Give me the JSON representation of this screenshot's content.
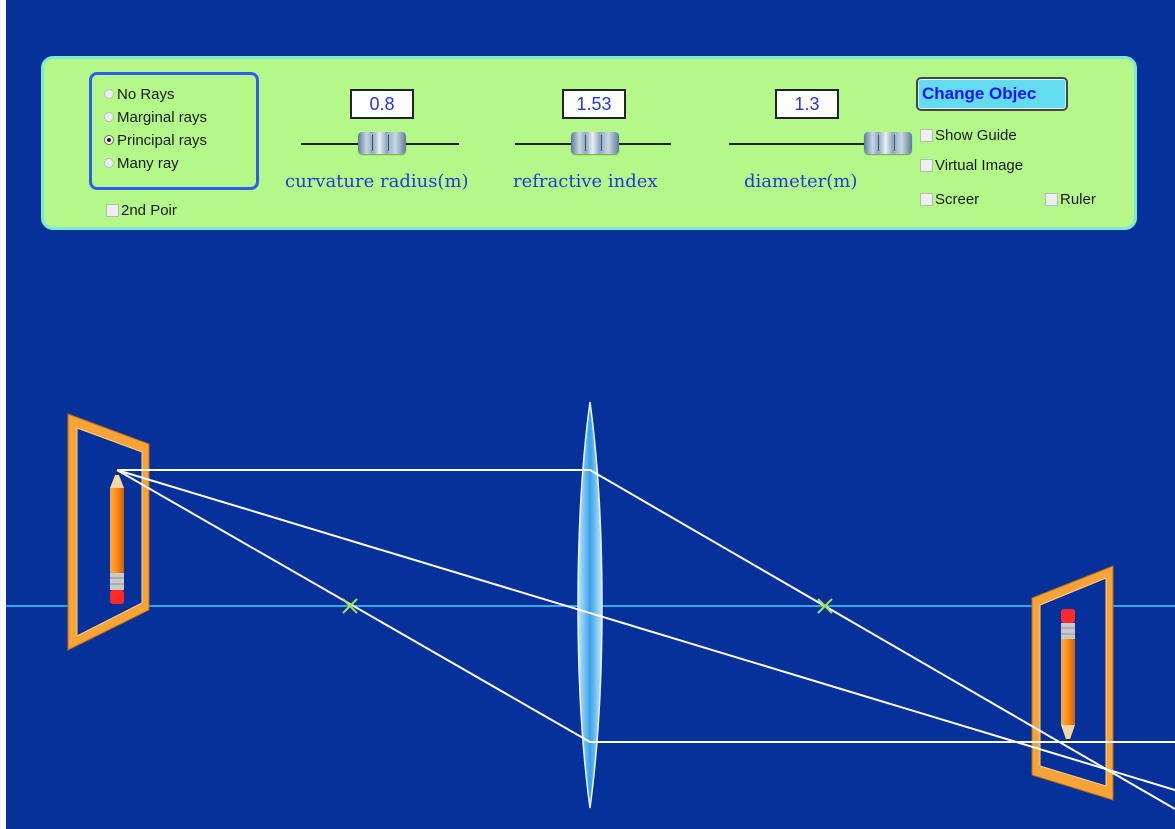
{
  "rays": {
    "options": [
      {
        "label": "No Rays",
        "selected": false
      },
      {
        "label": "Marginal rays",
        "selected": false
      },
      {
        "label": "Principal rays",
        "selected": true
      },
      {
        "label": "Many ray",
        "selected": false
      }
    ],
    "second_point_label": "2nd Poir",
    "second_point_checked": false
  },
  "sliders": {
    "curvature": {
      "value": "0.8",
      "label": "curvature radius(m)"
    },
    "refractive": {
      "value": "1.53",
      "label": "refractive index"
    },
    "diameter": {
      "value": "1.3",
      "label": "diameter(m)"
    }
  },
  "buttons": {
    "change_object": "Change Objec"
  },
  "options": {
    "show_guide": {
      "label": "Show Guide",
      "checked": false
    },
    "virtual_image": {
      "label": "Virtual Image",
      "checked": false
    },
    "screen": {
      "label": "Screer",
      "checked": false
    },
    "ruler": {
      "label": "Ruler",
      "checked": false
    }
  },
  "colors": {
    "background": "#06309a",
    "panel": "#b4f88a",
    "axis": "#3fd2ff",
    "ray": "#ffffff",
    "frame": "#f39a2c",
    "focal_mark": "#a8e04a"
  }
}
